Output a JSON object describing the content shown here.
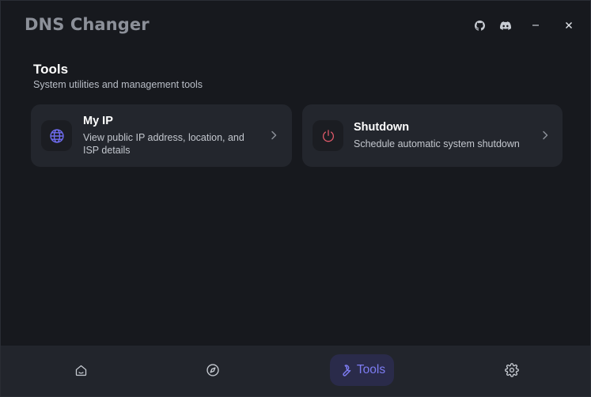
{
  "app": {
    "title": "DNS Changer"
  },
  "titlebar": {
    "icons": [
      "github-icon",
      "discord-icon",
      "minimize-icon",
      "close-icon"
    ]
  },
  "page": {
    "title": "Tools",
    "subtitle": "System utilities and management tools"
  },
  "tools": [
    {
      "title": "My IP",
      "description": "View public IP address, location, and ISP details",
      "icon": "globe-icon",
      "icon_color": "#6f6cf0"
    },
    {
      "title": "Shutdown",
      "description": "Schedule automatic system shutdown",
      "icon": "power-icon",
      "icon_color": "#e05a6a"
    }
  ],
  "nav": {
    "items": [
      {
        "id": "home",
        "icon": "home-icon"
      },
      {
        "id": "explore",
        "icon": "compass-icon"
      },
      {
        "id": "tools",
        "icon": "wrench-icon",
        "label": "Tools",
        "active": true
      },
      {
        "id": "settings",
        "icon": "gear-icon"
      }
    ],
    "active_color": "#7d7cf2",
    "inactive_color": "#c8ccd3"
  }
}
